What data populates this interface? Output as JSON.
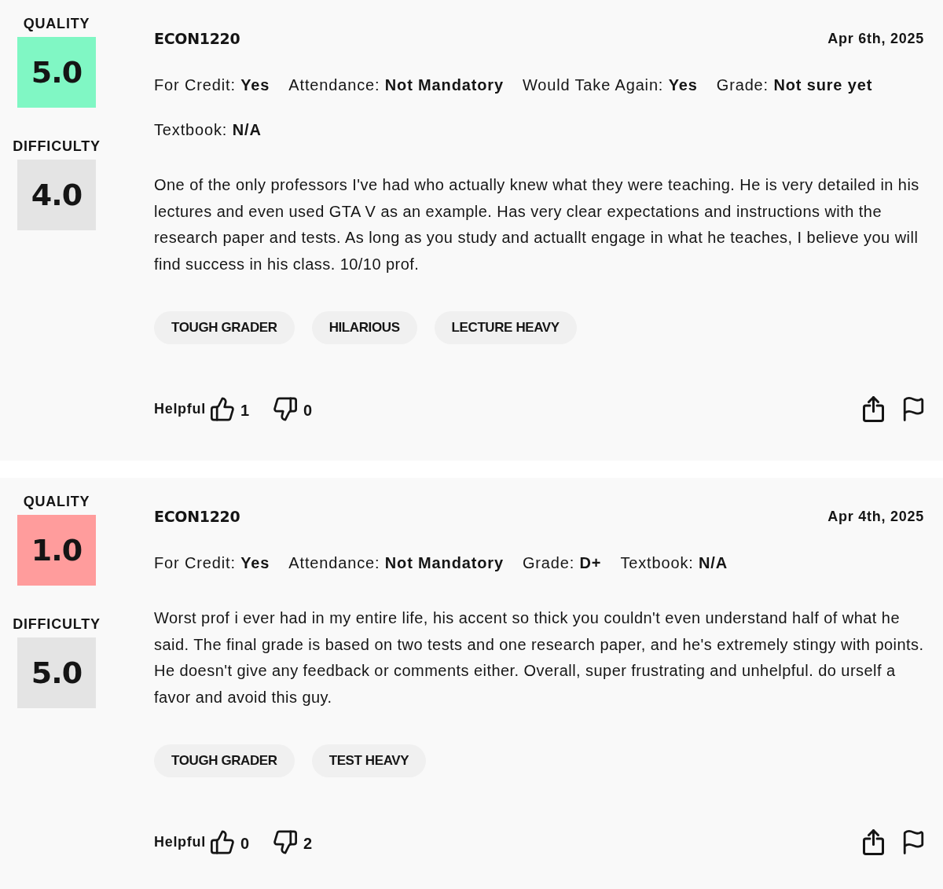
{
  "reviews": [
    {
      "quality": {
        "label": "QUALITY",
        "score": "5.0",
        "color": "#80f7c4"
      },
      "difficulty": {
        "label": "DIFFICULTY",
        "score": "4.0"
      },
      "course": "ECON1220",
      "date": "Apr 6th, 2025",
      "details": [
        {
          "label": "For Credit:",
          "value": "Yes"
        },
        {
          "label": "Attendance:",
          "value": "Not Mandatory"
        },
        {
          "label": "Would Take Again:",
          "value": "Yes"
        },
        {
          "label": "Grade:",
          "value": "Not sure yet"
        },
        {
          "label": "Textbook:",
          "value": "N/A"
        }
      ],
      "comment": "One of the only professors I've had who actually knew what they were teaching. He is very detailed in his lectures and even used GTA V as an example. Has very clear expectations and instructions with the research paper and tests. As long as you study and actuallt engage in what he teaches, I believe you will find success in his class. 10/10 prof.",
      "tags": [
        "TOUGH GRADER",
        "HILARIOUS",
        "LECTURE HEAVY"
      ],
      "helpful_label": "Helpful",
      "thumbs_up": "1",
      "thumbs_down": "0"
    },
    {
      "quality": {
        "label": "QUALITY",
        "score": "1.0",
        "color": "#ff9c9c"
      },
      "difficulty": {
        "label": "DIFFICULTY",
        "score": "5.0"
      },
      "course": "ECON1220",
      "date": "Apr 4th, 2025",
      "details": [
        {
          "label": "For Credit:",
          "value": "Yes"
        },
        {
          "label": "Attendance:",
          "value": "Not Mandatory"
        },
        {
          "label": "Grade:",
          "value": "D+"
        },
        {
          "label": "Textbook:",
          "value": "N/A"
        }
      ],
      "comment": "Worst prof i ever had in my entire life, his accent so thick you couldn't even understand half of what he said. The final grade is based on two tests and one research paper, and he's extremely stingy with points. He doesn't give any feedback or comments either. Overall, super frustrating and unhelpful. do urself a favor and avoid this guy.",
      "tags": [
        "TOUGH GRADER",
        "TEST HEAVY"
      ],
      "helpful_label": "Helpful",
      "thumbs_up": "0",
      "thumbs_down": "2"
    }
  ]
}
